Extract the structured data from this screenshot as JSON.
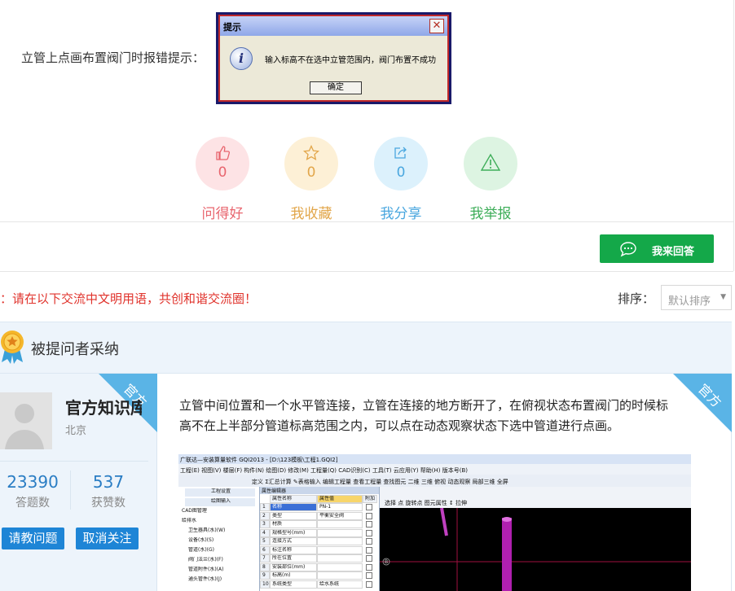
{
  "question": {
    "label": "立管上点画布置阀门时报错提示：",
    "dialog": {
      "title": "提示",
      "close": "✕",
      "message": "输入标高不在选中立管范围内，阀门布置不成功",
      "ok_label": "确定",
      "info_glyph": "i"
    }
  },
  "actions": [
    {
      "label": "问得好",
      "count": "0",
      "icon": "thumbs-up-icon",
      "bg": "#fde3e5",
      "color": "#e8656e"
    },
    {
      "label": "我收藏",
      "count": "0",
      "icon": "star-icon",
      "bg": "#fdf0d6",
      "color": "#e2a64a"
    },
    {
      "label": "我分享",
      "count": "0",
      "icon": "share-icon",
      "bg": "#dcf1fc",
      "color": "#4aa7df"
    },
    {
      "label": "我举报",
      "count": "",
      "icon": "warning-icon",
      "bg": "#ddf4e2",
      "color": "#3fae5a"
    }
  ],
  "answer_button": {
    "label": "我来回答",
    "icon": "chat-icon",
    "color": "#14a849"
  },
  "notice": "：请在以下交流中文明用语，共创和谐交流圈！",
  "sort": {
    "label": "排序：",
    "value": "默认排序",
    "arrow": "▼"
  },
  "accepted": {
    "label": "被提问者采纳",
    "ribbon": "官方",
    "user": {
      "name": "官方知识库",
      "location": "北京"
    },
    "stats": [
      {
        "value": "23390",
        "label": "答题数"
      },
      {
        "value": "537",
        "label": "获赞数"
      }
    ],
    "buttons": {
      "ask": "请教问题",
      "unfollow": "取消关注"
    },
    "answer": "立管中间位置和一个水平管连接，立管在连接的地方断开了，在俯视状态布置阀门的时候标高不在上半部分管道标高范围之内，可以点在动态观察状态下选中管道进行点画。",
    "screenshot": {
      "title": "广联达—安装算量软件 GQI2013 - [D:\\123模板\\工程1.GQI2]",
      "menu": "工程(E)  视图(V)  楼层(F)  构件(N)  绘图(D)  修改(M)  工程量(Q)  CAD识别(C)  工具(T)  云应用(Y)  帮助(H)  版本号(B)",
      "toolbar": "定义  Σ汇总计算  ✎表格输入  编辑工程量  查看工程量  查找图元  二维  三维  俯视  动态观察  局部三维  全屏",
      "left_items": [
        "工程设置",
        "绘图输入",
        "CAD图管理",
        "给排水",
        "卫生器具(水)(W)",
        "设备(水)(S)",
        "管道(水)(G)",
        "阀门法兰(水)(F)",
        "管道附件(水)(A)",
        "通头管件(水)(J)"
      ],
      "props_title": "属性编辑器",
      "props_header": [
        "属性名称",
        "属性值",
        "附加"
      ],
      "props_rows": [
        [
          "名称",
          "PN-1"
        ],
        [
          "类型",
          "平衡安全阀"
        ],
        [
          "材质",
          ""
        ],
        [
          "规格型号(mm)",
          ""
        ],
        [
          "连接方式",
          ""
        ],
        [
          "标注名称",
          ""
        ],
        [
          "所在位置",
          ""
        ],
        [
          "安装部位(mm)",
          ""
        ],
        [
          "标高(m)",
          ""
        ],
        [
          "系统类型",
          "给水系统"
        ]
      ],
      "canvas_toolbar": "选择  点  旋转点  图元属性  ↕ 拉伸"
    }
  }
}
